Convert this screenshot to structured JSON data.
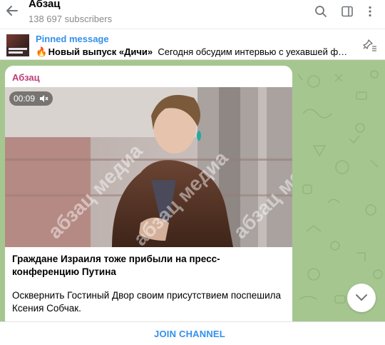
{
  "header": {
    "title": "Абзац",
    "subscribers": "138 697 subscribers"
  },
  "pinned": {
    "label": "Pinned message",
    "emoji": "🔥",
    "bold_text": "Новый выпуск «Дичи»",
    "text": "Сегодня обсудим интервью с уехавшей фем..."
  },
  "message": {
    "sender": "Абзац",
    "duration": "00:09",
    "watermark": "абзац медиа",
    "title": "Граждане Израиля тоже прибыли на пресс-конференцию Путина",
    "body": "Осквернить Гостиный Двор своим присутствием поспешила Ксения Собчак."
  },
  "footer": {
    "join_label": "JOIN CHANNEL"
  },
  "colors": {
    "accent": "#3390ec",
    "sender": "#c03d78",
    "chat_background": "#a6c690"
  }
}
